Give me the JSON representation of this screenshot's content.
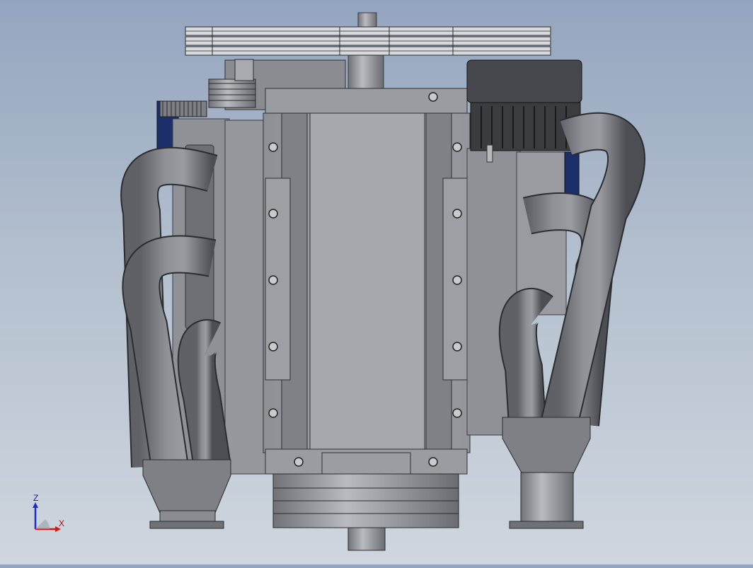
{
  "viewport": {
    "background_top": "#94a5bf",
    "background_bottom": "#cfd6df"
  },
  "model": {
    "body_color": "#a3a5ab",
    "dark_color": "#45474c",
    "accent_color": "#1c2f6b",
    "alternator_color": "#3a3c40"
  },
  "triad": {
    "z_label": "Z",
    "x_label": "X",
    "z_color": "#1a2fd0",
    "x_color": "#d01a1a"
  }
}
